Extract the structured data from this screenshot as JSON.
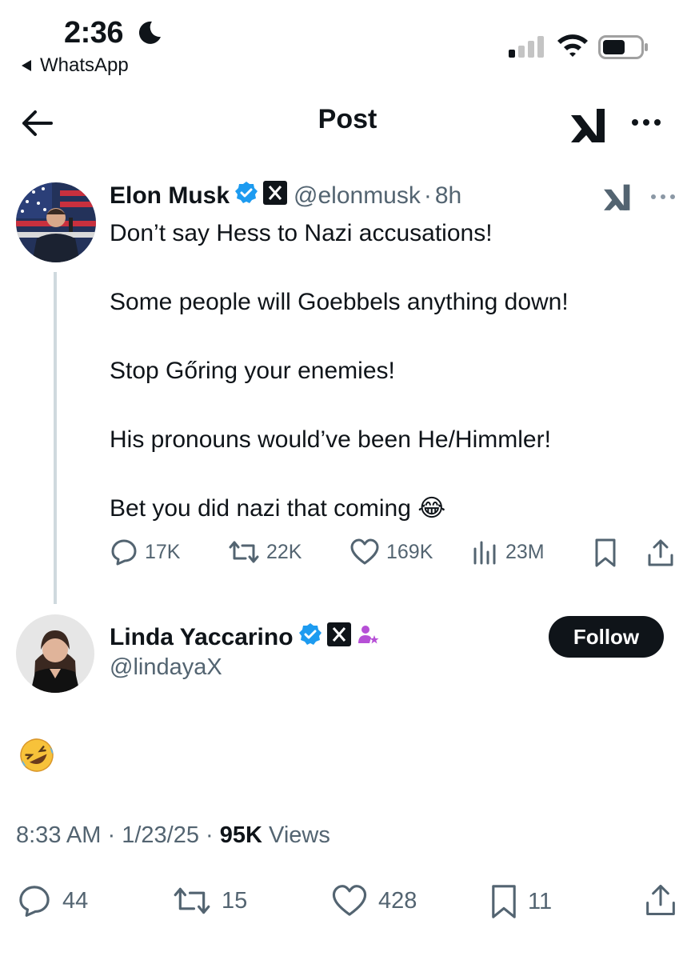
{
  "status_bar": {
    "time": "2:36",
    "back_app_label": "WhatsApp"
  },
  "header": {
    "title": "Post"
  },
  "post_main": {
    "author_name": "Elon Musk",
    "author_handle": "@elonmusk",
    "separator": "·",
    "age": "8h",
    "lines": [
      "Don’t say Hess to Nazi accusations!",
      "Some people will Goebbels anything down!",
      "Stop Gőring your enemies!",
      "His pronouns would’ve been He/Himmler!",
      "Bet you did nazi that coming 😂"
    ],
    "metrics": {
      "replies": "17K",
      "reposts": "22K",
      "likes": "169K",
      "views": "23M"
    }
  },
  "post_reply": {
    "author_name": "Linda Yaccarino",
    "author_handle": "@lindayaX",
    "follow_label": "Follow",
    "text": "🤣",
    "time": "8:33 AM",
    "date": "1/23/25",
    "views_count": "95K",
    "views_label": "Views",
    "dot": "·",
    "metrics": {
      "replies": "44",
      "reposts": "15",
      "likes": "428",
      "bookmarks": "11"
    }
  },
  "colors": {
    "verified": "#1d9bf0",
    "text": "#0f1419",
    "muted": "#536471",
    "thread_line": "#cfd9de"
  }
}
